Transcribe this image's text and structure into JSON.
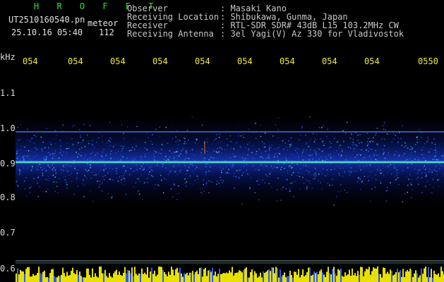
{
  "app_title": "H R O F F T",
  "file_name": "UT2510160540.pn",
  "file_suffix": "meteor",
  "date_time": "25.10.16 05:40",
  "count": "112",
  "info": {
    "labels": [
      "Observer",
      "Receiving Location",
      "Receiver",
      "Receiving Antenna"
    ],
    "values": [
      ": Masaki Kano",
      ": Shibukawa, Gunma, Japan",
      ": RTL-SDR SDR# 43dB L15 103.2MHz CW",
      ": 3el Yagi(V) Az 330 for Vladivostok"
    ]
  },
  "y_unit": "kHz",
  "y_ticks": [
    "1.1",
    "1.0",
    "0.9",
    "0.8",
    "0.7",
    "0.6"
  ],
  "x_ticks": [
    "054",
    "054",
    "054",
    "054",
    "054",
    "054",
    "054",
    "054",
    "054",
    "0550"
  ],
  "colors": {
    "tick_text": "#f2ea3a",
    "title_green": "#2ee52e",
    "bottom_band": "#e8e000",
    "signal": "#2a5cff"
  }
}
